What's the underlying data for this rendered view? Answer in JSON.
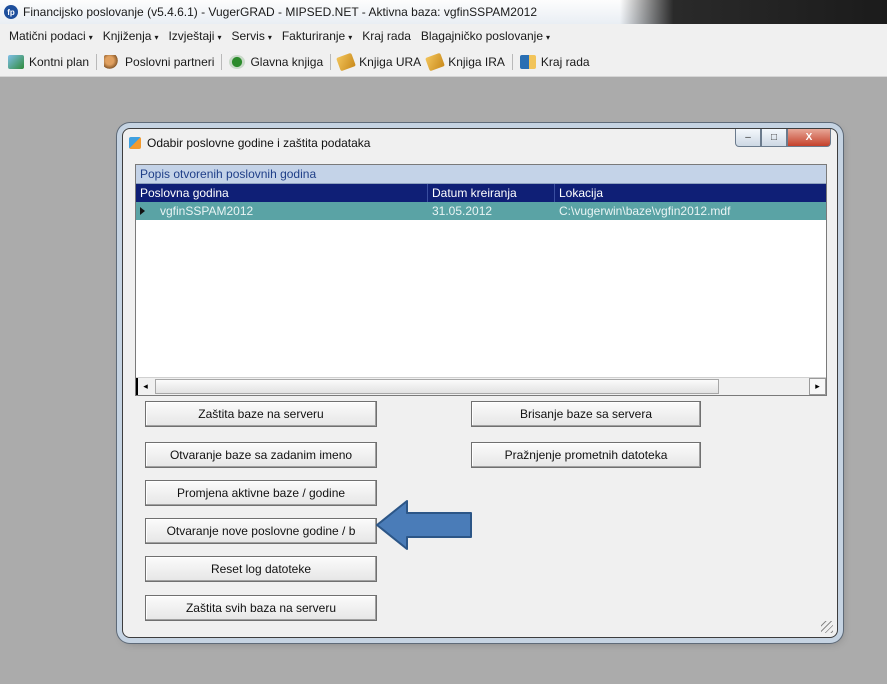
{
  "app": {
    "title": "Financijsko poslovanje (v5.4.6.1) - VugerGRAD - MIPSED.NET - Aktivna baza: vgfinSSPAM2012",
    "icon_letter": "fp"
  },
  "menu": [
    {
      "label": "Matični podaci",
      "arrow": "▾"
    },
    {
      "label": "Knjiženja",
      "arrow": "▾"
    },
    {
      "label": "Izvještaji",
      "arrow": "▾"
    },
    {
      "label": "Servis",
      "arrow": "▾"
    },
    {
      "label": "Fakturiranje",
      "arrow": "▾"
    },
    {
      "label": "Kraj rada"
    },
    {
      "label": "Blagajničko poslovanje",
      "arrow": "▾"
    }
  ],
  "toolbar": [
    {
      "label": "Kontni plan",
      "icon": "chart-of-accounts-icon"
    },
    {
      "label": "Poslovni partneri",
      "icon": "partners-icon"
    },
    {
      "label": "Glavna knjiga",
      "icon": "general-ledger-icon"
    },
    {
      "label": "Knjiga URA",
      "icon": "book-icon"
    },
    {
      "label": "Knjiga IRA",
      "icon": "book-icon"
    },
    {
      "label": "Kraj rada",
      "icon": "exit-door-icon"
    }
  ],
  "dialog": {
    "title": "Odabir poslovne godine i zaštita podataka",
    "window_buttons": {
      "minimize": "–",
      "maximize": "□",
      "close": "X"
    },
    "group_header": "Popis otvorenih poslovnih godina",
    "columns": [
      "Poslovna godina",
      "Datum kreiranja",
      "Lokacija"
    ],
    "rows": [
      {
        "year": "vgfinSSPAM2012",
        "created": "31.05.2012",
        "location": "C:\\vugerwin\\baze\\vgfin2012.mdf",
        "selected": true
      }
    ],
    "scroll_arrows": {
      "left": "◂",
      "right": "▸"
    },
    "buttons_left": [
      "Zaštita baze na serveru",
      "Otvaranje baze sa zadanim imeno",
      "Promjena aktivne baze / godine",
      "Otvaranje nove poslovne godine / b",
      "Reset log datoteke",
      "Zaštita svih baza na serveru"
    ],
    "buttons_right": [
      "Brisanje baze sa servera",
      "Pražnjenje prometnih datoteka"
    ]
  },
  "colors": {
    "column_header_bg": "#0f1f76",
    "selected_row_bg": "#5aa3a5",
    "group_header_bg": "#c4d3e8",
    "annotation_arrow": "#4a7cb8"
  }
}
